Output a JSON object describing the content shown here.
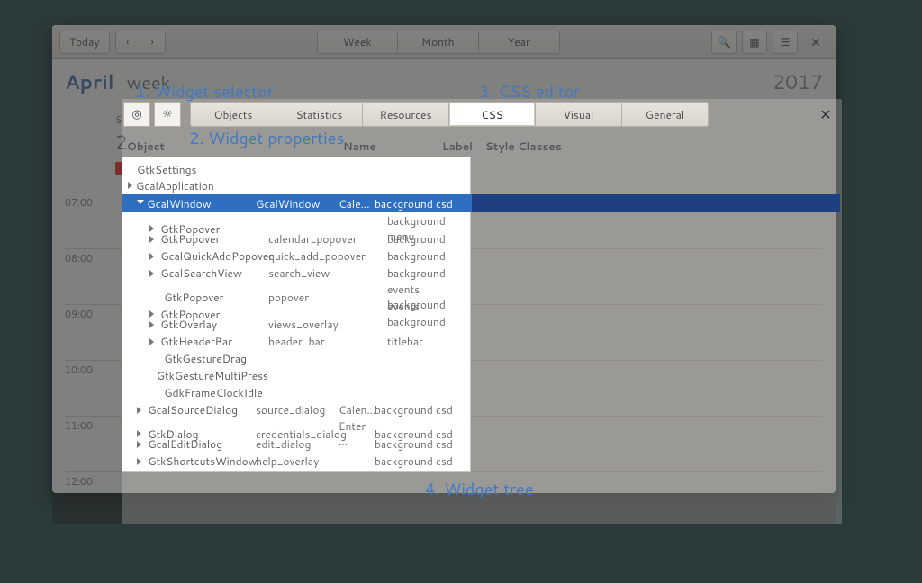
{
  "calendar": {
    "today_label": "Today",
    "view_week": "Week",
    "view_month": "Month",
    "view_year": "Year",
    "month": "April",
    "week_text": "week",
    "year": "2017",
    "day_label": "SUN",
    "day_number": "2",
    "times": [
      "07:00",
      "08:00",
      "09:00",
      "10:00",
      "11:00",
      "12:00"
    ]
  },
  "annotations": {
    "a1": "1. Widget selector",
    "a2": "2. Widget properties",
    "a3": "3. CSS editor",
    "a4": "4. Widget tree"
  },
  "inspector": {
    "tabs": [
      "Objects",
      "Statistics",
      "Resources",
      "CSS",
      "Visual",
      "General"
    ],
    "active_tab": "CSS",
    "columns": {
      "c1": "Object",
      "c2": "Name",
      "c3": "Label",
      "c4": "Style Classes"
    },
    "prelist": [
      "GtkSettings",
      "GcalApplication"
    ],
    "selected": {
      "object": "GcalWindow",
      "name": "GcalWindow",
      "label": "Calen…",
      "classes": "background csd"
    },
    "children": [
      {
        "object": "GtkPopover",
        "name": "",
        "label": "",
        "classes": "background menu",
        "tri": true
      },
      {
        "object": "GtkPopover",
        "name": "calendar_popover",
        "label": "",
        "classes": "background",
        "tri": true
      },
      {
        "object": "GcalQuickAddPopover",
        "name": "quick_add_popover",
        "label": "",
        "classes": "background",
        "tri": true
      },
      {
        "object": "GcalSearchView",
        "name": "search_view",
        "label": "",
        "classes": "background",
        "tri": true
      },
      {
        "object": "GtkPopover",
        "name": "popover",
        "label": "",
        "classes": "events background",
        "tri": false
      },
      {
        "object": "GtkPopover",
        "name": "",
        "label": "",
        "classes": "events background",
        "tri": true
      },
      {
        "object": "GtkOverlay",
        "name": "views_overlay",
        "label": "",
        "classes": "",
        "tri": true
      },
      {
        "object": "GtkHeaderBar",
        "name": "header_bar",
        "label": "",
        "classes": "titlebar",
        "tri": true
      },
      {
        "object": "GtkGestureDrag",
        "name": "",
        "label": "",
        "classes": "",
        "tri": false
      },
      {
        "object": "GtkGestureMultiPress",
        "name": "",
        "label": "",
        "classes": "",
        "tri": false
      },
      {
        "object": "GdkFrameClockIdle",
        "name": "",
        "label": "",
        "classes": "",
        "tri": false
      }
    ],
    "siblings_after": [
      {
        "object": "GcalSourceDialog",
        "name": "source_dialog",
        "label": "Calen…",
        "classes": "background csd"
      },
      {
        "object": "GtkDialog",
        "name": "credentials_dialog",
        "label": "Enter …",
        "classes": "background csd"
      },
      {
        "object": "GcalEditDialog",
        "name": "edit_dialog",
        "label": "",
        "classes": "background csd"
      },
      {
        "object": "GtkShortcutsWindow",
        "name": "help_overlay",
        "label": "",
        "classes": "background csd"
      }
    ]
  }
}
